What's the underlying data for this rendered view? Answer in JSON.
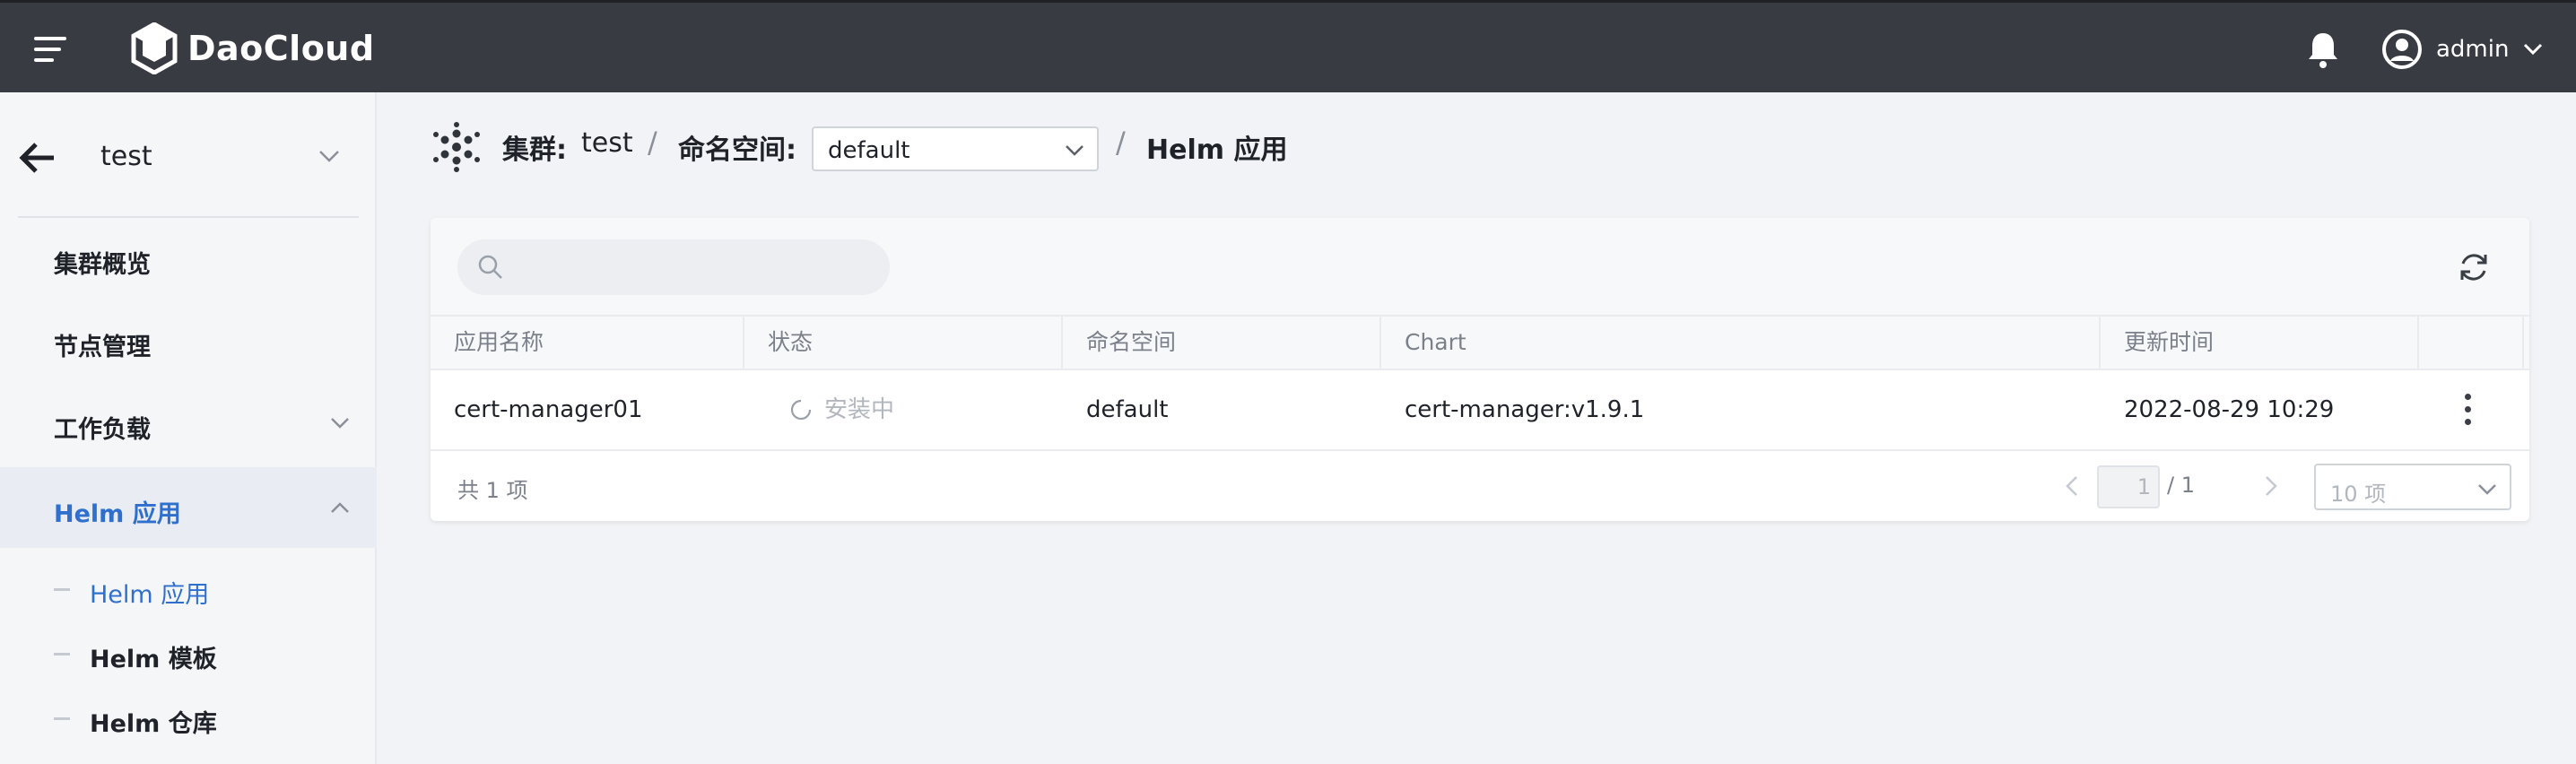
{
  "topbar": {
    "brand": "DaoCloud",
    "user_name": "admin"
  },
  "sidebar": {
    "cluster": "test",
    "items": [
      {
        "label": "集群概览"
      },
      {
        "label": "节点管理"
      },
      {
        "label": "工作负载"
      },
      {
        "label": "Helm 应用"
      }
    ],
    "sub_items": [
      {
        "label": "Helm 应用"
      },
      {
        "label": "Helm 模板"
      },
      {
        "label": "Helm 仓库"
      }
    ]
  },
  "breadcrumb": {
    "cluster_label": "集群:",
    "cluster_value": "test",
    "sep": "/",
    "namespace_label": "命名空间:",
    "namespace_value": "default",
    "current": "Helm 应用"
  },
  "table": {
    "search_placeholder": "",
    "columns": [
      "应用名称",
      "状态",
      "命名空间",
      "Chart",
      "更新时间"
    ],
    "rows": [
      {
        "name": "cert-manager01",
        "status": "安装中",
        "namespace": "default",
        "chart": "cert-manager:v1.9.1",
        "updated": "2022-08-29 10:29"
      }
    ],
    "total": "共 1 项",
    "page_current": "1",
    "page_total": "/ 1",
    "page_size": "10 项"
  },
  "colors": {
    "topbar": "#383b41",
    "accent": "#2f6fce",
    "sidebar_active_bg": "#e9ecf3"
  }
}
